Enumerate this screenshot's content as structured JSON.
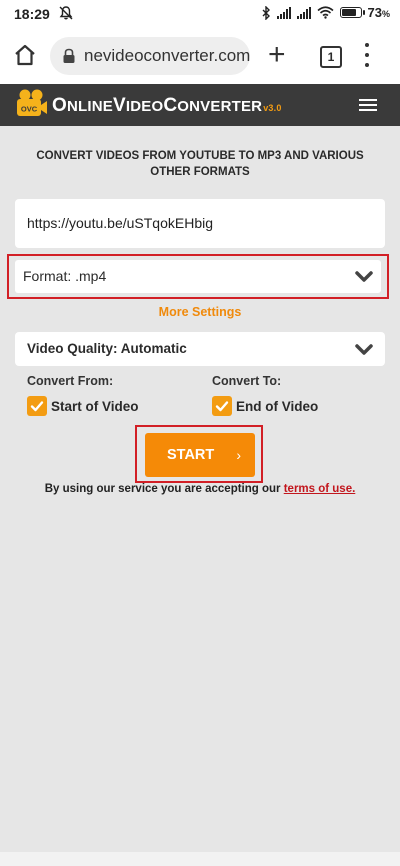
{
  "status_bar": {
    "time": "18:29",
    "battery_percent": "73",
    "battery_unit": "%",
    "icons": [
      "mute-icon",
      "bluetooth-icon",
      "signal-icon",
      "signal-icon",
      "wifi-icon",
      "battery-icon"
    ]
  },
  "browser": {
    "url_text": "nevideoconverter.com",
    "tab_count": "1",
    "icons": [
      "home-icon",
      "lock-icon",
      "new-tab-icon",
      "tabs-icon",
      "more-menu-icon"
    ]
  },
  "site": {
    "logo_text": "OVC",
    "brand_cap1": "O",
    "brand_rest1": "NLINE",
    "brand_cap2": "V",
    "brand_rest2": "IDEO",
    "brand_cap3": "C",
    "brand_rest3": "ONVERTER",
    "version": "v3.0",
    "accent_color": "#f39c12",
    "header_bg": "#3a3a3a"
  },
  "main": {
    "headline": "CONVERT VIDEOS FROM YOUTUBE TO MP3 AND VARIOUS OTHER FORMATS",
    "url_value": "https://youtu.be/uSTqokEHbig",
    "format_label": "Format: .mp4",
    "more_settings": "More Settings",
    "quality_label": "Video Quality: Automatic",
    "convert_from_label": "Convert From:",
    "convert_to_label": "Convert To:",
    "from_option": "Start of Video",
    "to_option": "End of Video",
    "from_checked": true,
    "to_checked": true,
    "start_button": "START",
    "start_arrow": "›",
    "terms_prefix": "By using our service you are accepting our",
    "terms_link": "terms of use.",
    "highlight_color": "#d21f26",
    "button_color": "#f58a07"
  }
}
